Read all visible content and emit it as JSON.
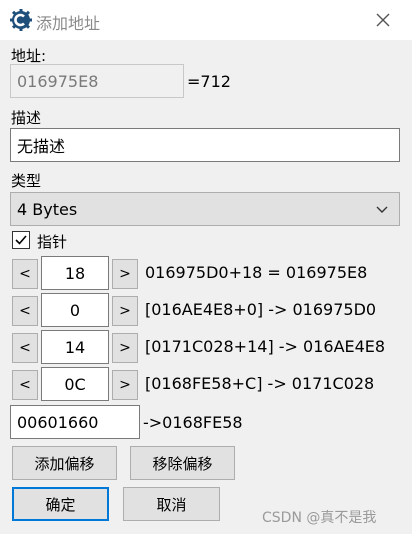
{
  "window": {
    "title": "添加地址",
    "icon": "cheat-engine-icon",
    "close_icon": "close-icon"
  },
  "address": {
    "label": "地址:",
    "value": "016975E8",
    "result": "=712"
  },
  "description": {
    "label": "描述",
    "value": "无描述"
  },
  "type": {
    "label": "类型",
    "selected": "4 Bytes"
  },
  "pointer": {
    "checked": true,
    "label": "指针",
    "rows": [
      {
        "dec": "<",
        "inc": ">",
        "offset": "18",
        "text": "016975D0+18 = 016975E8"
      },
      {
        "dec": "<",
        "inc": ">",
        "offset": "0",
        "text": "[016AE4E8+0] -> 016975D0"
      },
      {
        "dec": "<",
        "inc": ">",
        "offset": "14",
        "text": "[0171C028+14] -> 016AE4E8"
      },
      {
        "dec": "<",
        "inc": ">",
        "offset": "0C",
        "text": "[0168FE58+C] -> 0171C028"
      }
    ],
    "base_address": "00601660",
    "base_result": "->0168FE58"
  },
  "buttons": {
    "add_offset": "添加偏移",
    "remove_offset": "移除偏移",
    "ok": "确定",
    "cancel": "取消"
  },
  "watermark": "CSDN @真不是我"
}
